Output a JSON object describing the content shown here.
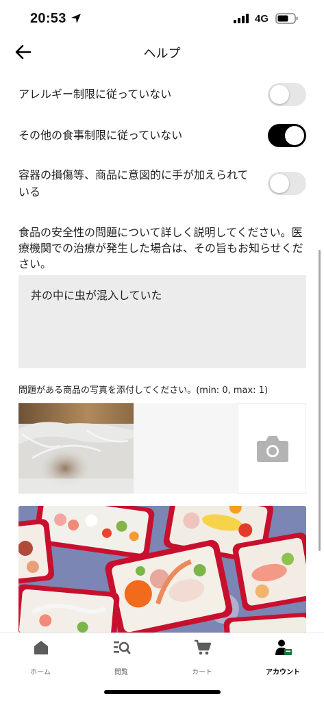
{
  "status_bar": {
    "time": "20:53",
    "network": "4G"
  },
  "header": {
    "title": "ヘルプ"
  },
  "toggles": [
    {
      "label": "アレルギー制限に従っていない",
      "on": false
    },
    {
      "label": "その他の食事制限に従っていない",
      "on": true
    },
    {
      "label": "容器の損傷等、商品に意図的に手が加えられている",
      "on": false
    }
  ],
  "form": {
    "description": "食品の安全性の問題について詳しく説明してください。医療機関での治療が発生した場合は、その旨もお知らせください。",
    "issue_text": "丼の中に虫が混入していた",
    "photo_instruction": "問題がある商品の写真を添付してください。(min: 0, max: 1)"
  },
  "tab_bar": [
    {
      "label": "ホーム",
      "icon": "home-icon",
      "active": false
    },
    {
      "label": "閲覧",
      "icon": "browse-icon",
      "active": false
    },
    {
      "label": "カート",
      "icon": "cart-icon",
      "active": false
    },
    {
      "label": "アカウント",
      "icon": "account-icon",
      "active": true
    }
  ],
  "colors": {
    "toggle_on": "#000000",
    "toggle_off": "#e6e6e6",
    "input_bg": "#ececec",
    "camera_icon": "#b3b3b3"
  }
}
